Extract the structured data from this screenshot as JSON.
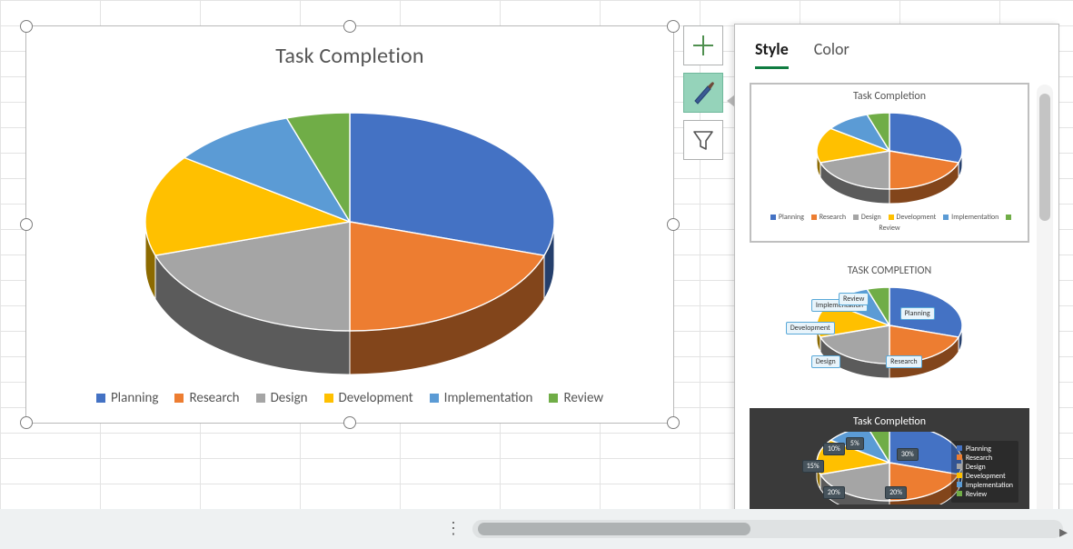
{
  "chart_data": {
    "type": "pie",
    "title": "Task Completion",
    "series": [
      {
        "name": "Planning",
        "value": 30,
        "color": "#4472c4"
      },
      {
        "name": "Research",
        "value": 20,
        "color": "#ed7d31"
      },
      {
        "name": "Design",
        "value": 20,
        "color": "#a5a5a5"
      },
      {
        "name": "Development",
        "value": 15,
        "color": "#ffc000"
      },
      {
        "name": "Implementation",
        "value": 10,
        "color": "#5b9bd5"
      },
      {
        "name": "Review",
        "value": 5,
        "color": "#70ad47"
      }
    ],
    "legend_position": "bottom",
    "style": "3d"
  },
  "toolbar": {
    "chart_elements_tooltip": "Chart Elements",
    "chart_styles_tooltip": "Chart Styles",
    "chart_filters_tooltip": "Chart Filters"
  },
  "gallery": {
    "tabs": {
      "style": "Style",
      "color": "Color"
    },
    "active_tab": "style",
    "thumbnails": [
      {
        "title": "Task Completion",
        "selected": true,
        "variant": "legend-bottom"
      },
      {
        "title": "TASK COMPLETION",
        "selected": false,
        "variant": "labels-on-slices"
      },
      {
        "title": "Task Completion",
        "selected": false,
        "variant": "dark-percent"
      }
    ]
  }
}
